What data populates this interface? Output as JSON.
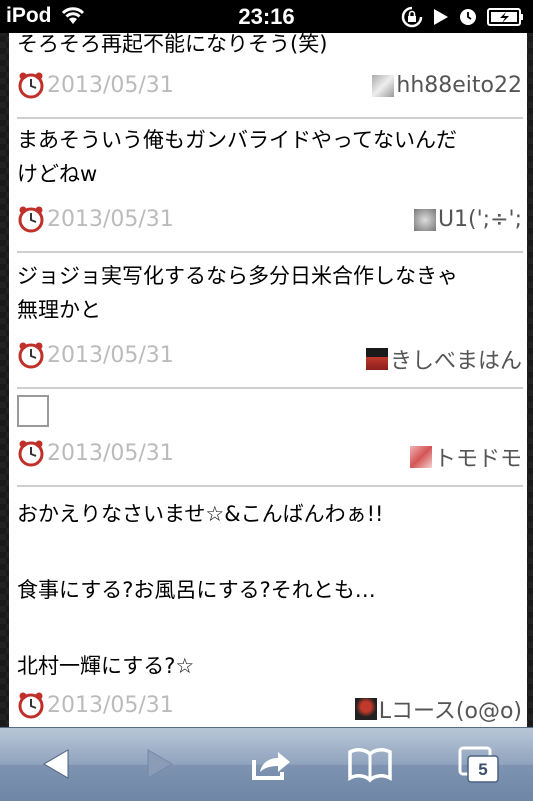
{
  "status_bar": {
    "carrier": "iPod",
    "time": "23:16",
    "icons": [
      "wifi-icon",
      "rotation-lock-icon",
      "play-icon",
      "alarm-clock-icon",
      "battery-charging-icon"
    ]
  },
  "posts": [
    {
      "text": "そろそろ再起不能になりそう(笑)",
      "date": "2013/05/31",
      "user": "hh88eito22",
      "avatar": "user-avatar-icon"
    },
    {
      "text": "まあそういう俺もガンバライドやってないんだ\nけどねw",
      "date": "2013/05/31",
      "user": "U1(';÷';",
      "avatar": "user-avatar-icon"
    },
    {
      "text": "ジョジョ実写化するなら多分日米合作しなきゃ\n無理かと",
      "date": "2013/05/31",
      "user": "きしべまはん",
      "avatar": "user-avatar-icon"
    },
    {
      "text": "",
      "date": "2013/05/31",
      "user": "トモドモ",
      "avatar": "user-avatar-icon"
    },
    {
      "text": "おかえりなさいませ☆&こんばんわぁ!!\n\n食事にする?お風呂にする?それとも…\n\n北村一輝にする?☆",
      "date": "2013/05/31",
      "user": "Lコース(o@o)",
      "avatar": "user-avatar-icon"
    }
  ],
  "toolbar": {
    "tabs_count": "5",
    "buttons": [
      "back-icon",
      "forward-icon",
      "share-icon",
      "bookmarks-icon",
      "tabs-icon"
    ]
  }
}
